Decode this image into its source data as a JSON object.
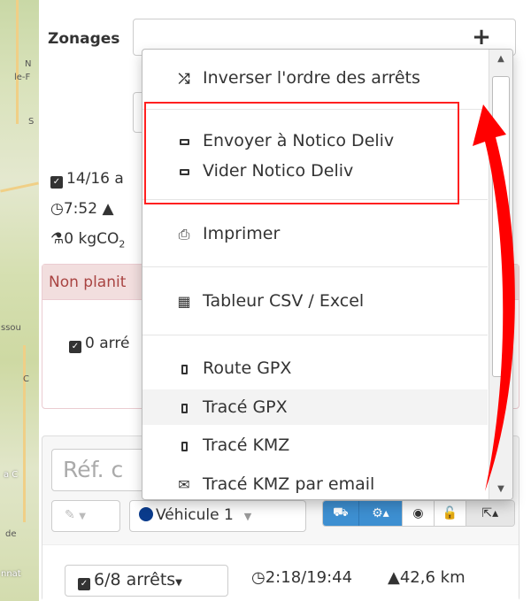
{
  "map": {
    "labels": [
      "N",
      "le-F",
      "S",
      "ssou",
      "C",
      "a C",
      "de",
      "nnat"
    ]
  },
  "zonages": {
    "label": "Zonages",
    "add_label": "+"
  },
  "summary": {
    "stops": "14/16 a",
    "time": "7:52",
    "co2_prefix": "0 kgCO",
    "co2_sub": "2"
  },
  "non_planned": {
    "header": "Non planit",
    "stops": "0 arré"
  },
  "tour": {
    "ref_placeholder": "Réf. c",
    "vehicle": "Véhicule 1",
    "stops": "6/8 arrêts",
    "time": "2:18/19:44",
    "distance": "42,6 km"
  },
  "menu": {
    "items": [
      {
        "label": "Inverser l'ordre des arrêts",
        "icon": "shuffle-icon"
      },
      {
        "label": "Envoyer à Notico Deliv",
        "icon": "rectangle-icon"
      },
      {
        "label": "Vider Notico Deliv",
        "icon": "rectangle-icon"
      },
      {
        "label": "Imprimer",
        "icon": "print-icon"
      },
      {
        "label": "Tableur CSV / Excel",
        "icon": "table-icon"
      },
      {
        "label": "Route GPX",
        "icon": "mobile-icon"
      },
      {
        "label": "Tracé GPX",
        "icon": "mobile-icon"
      },
      {
        "label": "Tracé KMZ",
        "icon": "mobile-icon"
      },
      {
        "label": "Tracé KMZ par email",
        "icon": "envelope-icon"
      }
    ]
  },
  "colors": {
    "highlight_box": "#ff2020",
    "arrow": "#ff0000",
    "vehicle_dot": "#0a3b8c",
    "button_blue": "#3d8fd1",
    "nonplan_header_bg": "#f2dede"
  }
}
